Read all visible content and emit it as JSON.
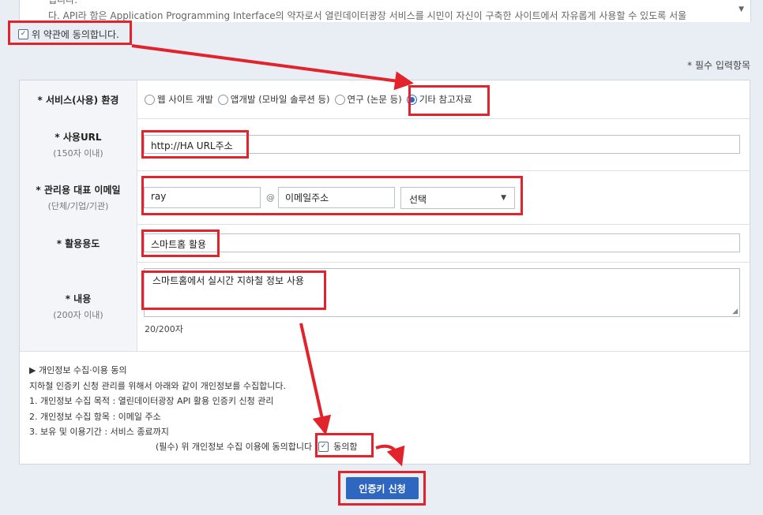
{
  "terms": {
    "line1": "됩니다.",
    "line2": "다. API라 함은 Application Programming Interface의 약자로서 열린데이터광장 서비스를 시민이 자신이 구축한 사이트에서 자유롭게 사용할 수 있도록 서울",
    "agree_label": "위 약관에 동의합니다.",
    "agree_checked": true
  },
  "required_note": "* 필수 입력항목",
  "form": {
    "service_env": {
      "label": "* 서비스(사용) 환경",
      "options": [
        "웹 사이트 개발",
        "앱개발 (모바일 솔루션 등)",
        "연구 (논문 등)",
        "기타 참고자료"
      ],
      "selected_index": 3
    },
    "url": {
      "label": "* 사용URL",
      "sublabel": "(150자 이내)",
      "value": "http://HA URL주소"
    },
    "email": {
      "label": "* 관리용 대표 이메일",
      "sublabel": "(단체/기업/기관)",
      "local": "ray",
      "at": "@",
      "domain": "이메일주소",
      "select_value": "선택"
    },
    "usage": {
      "label": "* 활용용도",
      "value": "스마트홈 활용"
    },
    "content": {
      "label": "* 내용",
      "sublabel": "(200자 이내)",
      "value": "스마트홈에서 실시간 지하철 정보 사용",
      "count": "20/200자"
    }
  },
  "privacy": {
    "header": "▶ 개인정보 수집·이용 동의",
    "lines": [
      "지하철 인증키 신청 관리를 위해서 아래와 같이 개인정보를 수집합니다.",
      "1. 개인정보 수집 목적 : 열린데이터광장 API 활용 인증키 신청 관리",
      "2. 개인정보 수집 항목 : 이메일 주소",
      "3. 보유 및 이용기간 : 서비스 종료까지"
    ],
    "agree_text": "(필수) 위 개인정보 수집 이용에 동의합니다",
    "agree_label": "동의함",
    "agree_checked": true
  },
  "submit_label": "인증키 신청",
  "colors": {
    "highlight": "#e2232b",
    "primary": "#2f66c0"
  }
}
